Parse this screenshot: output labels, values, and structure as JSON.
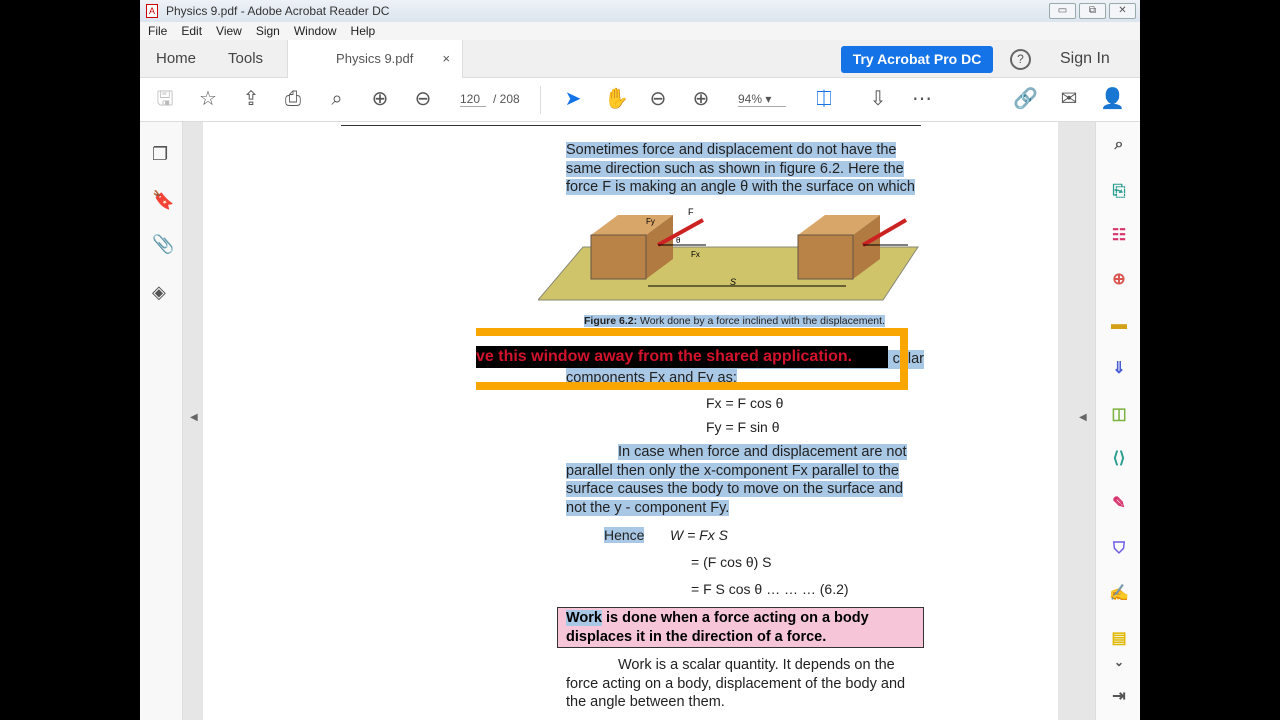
{
  "window": {
    "title": "Physics 9.pdf - Adobe Acrobat Reader DC",
    "min": "▭",
    "restore": "⧉",
    "close": "✕"
  },
  "menu": [
    "File",
    "Edit",
    "View",
    "Sign",
    "Window",
    "Help"
  ],
  "tabs": {
    "home": "Home",
    "tools": "Tools",
    "doc": "Physics 9.pdf",
    "close": "×",
    "try": "Try Acrobat Pro DC",
    "help": "?",
    "signin": "Sign In"
  },
  "toolbar": {
    "page": "120",
    "total": "/ 208",
    "zoom": "94%"
  },
  "doc": {
    "p1": [
      "Sometimes force and displacement do not have the",
      "same direction such as shown in figure 6.2. Here the",
      "force F is making an angle θ with the surface on which"
    ],
    "fig_caption_bold": "Figure 6.2:",
    "fig_caption": " Work done by a force inclined with the displacement.",
    "fig_labels": {
      "F": "F",
      "Fy": "Fy",
      "Fx": "Fx",
      "theta": "θ",
      "S": "S"
    },
    "overlay": "ve this window away from the shared application.",
    "overlay_tail": "cular",
    "components": "components Fx and Fy as:",
    "eq1": "Fx =   F cos θ",
    "eq2": "Fy =   F sin θ",
    "p2": [
      "In case when force and displacement are not",
      "parallel then only the x-component Fx parallel to the",
      "surface causes the body to move on the surface and",
      "not the y - component Fy."
    ],
    "hence": "Hence",
    "w1": "W  =  Fx S",
    "w2": "=  (F cos θ) S",
    "w3": "=  F S cos θ    …    …    … (6.2)",
    "def_word": "Work",
    "def_rest": " is done when a force acting on a body",
    "def_line2": "displaces it in the direction of a force.",
    "p3": [
      "Work is a scalar quantity. It depends on the",
      "force acting on a body, displacement of the body and",
      "the angle between them."
    ]
  }
}
